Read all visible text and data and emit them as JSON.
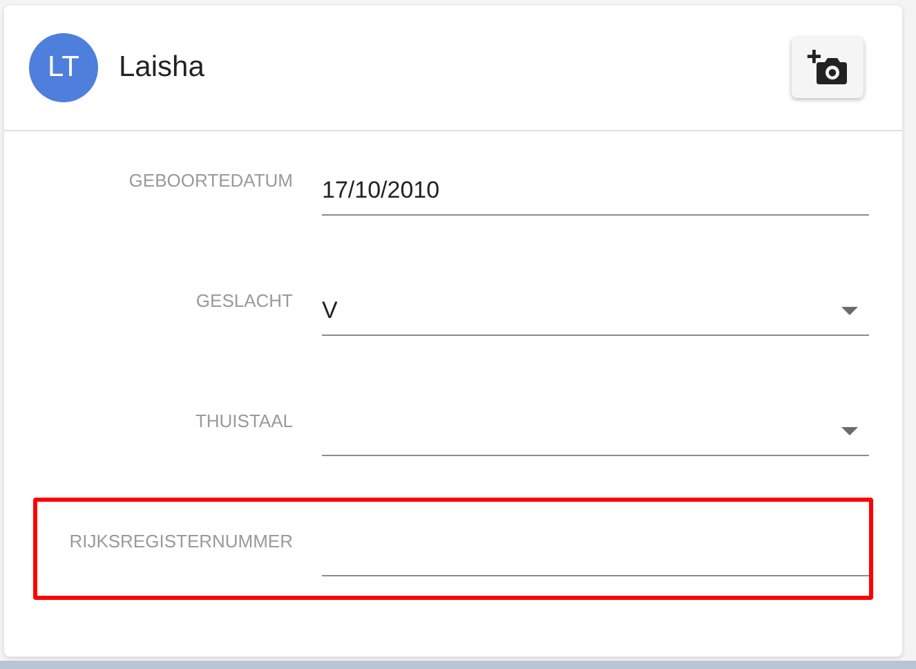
{
  "profile": {
    "initials": "LT",
    "name": "Laisha"
  },
  "fields": [
    {
      "kind": "text",
      "label": "GEBOORTEDATUM",
      "value": "17/10/2010",
      "highlighted": false
    },
    {
      "kind": "select",
      "label": "GESLACHT",
      "value": "V",
      "highlighted": false
    },
    {
      "kind": "select",
      "label": "THUISTAAL",
      "highlighted": false
    },
    {
      "kind": "text",
      "label": "RIJKSREGISTERNUMMER",
      "highlighted": true
    }
  ]
}
